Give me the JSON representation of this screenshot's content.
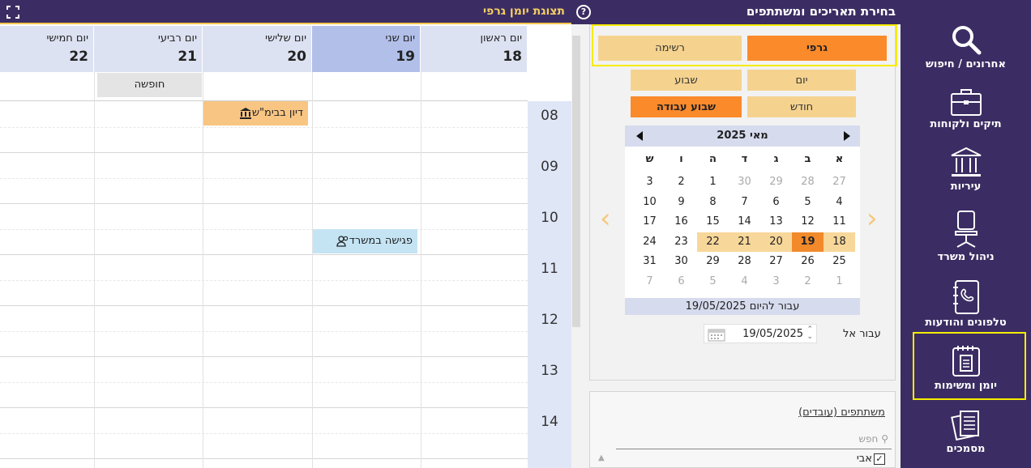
{
  "diary": {
    "title": "תצוגת יומן גרפי",
    "days": [
      {
        "name": "יום ראשון",
        "date": "18"
      },
      {
        "name": "יום שני",
        "date": "19"
      },
      {
        "name": "יום שלישי",
        "date": "20"
      },
      {
        "name": "יום רביעי",
        "date": "21"
      },
      {
        "name": "יום חמישי",
        "date": "22"
      }
    ],
    "holiday_label": "חופשה",
    "hours": [
      "08",
      "09",
      "10",
      "11",
      "12",
      "13",
      "14"
    ],
    "events": {
      "court": "דיון בבימ\"ש",
      "meeting": "פגישה במשרד"
    }
  },
  "panel": {
    "title": "בחירת תאריכים ומשתתפים",
    "view_buttons": {
      "graphic": "גרפי",
      "list": "רשימה",
      "day": "יום",
      "week": "שבוע",
      "month": "חודש",
      "work_week": "שבוע עבודה"
    },
    "goto_label": "עבור אל",
    "goto_value": "19/05/2025",
    "participants_label": "משתתפים (עובדים)",
    "search_placeholder": "חפש",
    "participant": "אבי"
  },
  "calendar": {
    "month_label": "מאי 2025",
    "weekday_headers": [
      "א",
      "ב",
      "ג",
      "ד",
      "ה",
      "ו",
      "ש"
    ],
    "weeks": [
      [
        "27",
        "28",
        "29",
        "30",
        "1",
        "2",
        "3"
      ],
      [
        "4",
        "5",
        "6",
        "7",
        "8",
        "9",
        "10"
      ],
      [
        "11",
        "12",
        "13",
        "14",
        "15",
        "16",
        "17"
      ],
      [
        "18",
        "19",
        "20",
        "21",
        "22",
        "23",
        "24"
      ],
      [
        "25",
        "26",
        "27",
        "28",
        "29",
        "30",
        "31"
      ],
      [
        "1",
        "2",
        "3",
        "4",
        "5",
        "6",
        "7"
      ]
    ],
    "today_label": "עבור להיום 19/05/2025"
  },
  "nav": {
    "items": [
      {
        "label": "אחרונים / חיפוש",
        "icon": "search-icon"
      },
      {
        "label": "תיקים ולקוחות",
        "icon": "briefcase-icon"
      },
      {
        "label": "עיריות",
        "icon": "building-icon"
      },
      {
        "label": "ניהול משרד",
        "icon": "chair-icon"
      },
      {
        "label": "טלפונים והודעות",
        "icon": "phone-book-icon"
      },
      {
        "label": "יומן ומשימות",
        "icon": "calendar-clipboard-icon"
      },
      {
        "label": "מסמכים",
        "icon": "documents-icon"
      }
    ]
  },
  "colors": {
    "nav_bg": "#3b2d63",
    "accent_orange": "#fb8a2b",
    "light_orange": "#f5d38f",
    "header_blue": "#dde2f2",
    "selected_blue": "#b2bfe9",
    "highlight_yellow": "#f5ec00"
  }
}
